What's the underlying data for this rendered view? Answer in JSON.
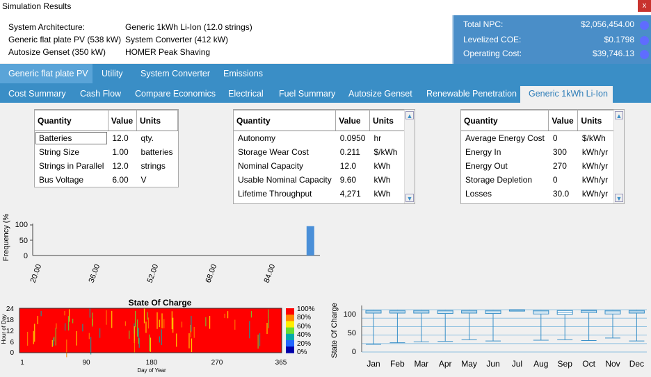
{
  "window": {
    "title": "Simulation Results",
    "close_label": "x"
  },
  "architecture": {
    "rows": [
      {
        "label": "System Architecture:",
        "value": "Generic 1kWh Li-Ion (12.0 strings)"
      },
      {
        "label": "Generic flat plate PV (538 kW)",
        "value": "System Converter (412 kW)"
      },
      {
        "label": "Autosize Genset (350 kW)",
        "value": "HOMER Peak Shaving"
      }
    ]
  },
  "summary": {
    "rows": [
      {
        "label": "Total NPC:",
        "value": "$2,056,454.00"
      },
      {
        "label": "Levelized COE:",
        "value": "$0.1798"
      },
      {
        "label": "Operating Cost:",
        "value": "$39,746.13"
      }
    ]
  },
  "tabs_top": [
    "Generic flat plate PV",
    "Utility",
    "System Converter",
    "Emissions"
  ],
  "tabs_sub": [
    "Cost Summary",
    "Cash Flow",
    "Compare Economics",
    "Electrical",
    "Fuel Summary",
    "Autosize Genset",
    "Renewable Penetration",
    "Generic 1kWh Li-Ion"
  ],
  "table1": {
    "headers": [
      "Quantity",
      "Value",
      "Units"
    ],
    "rows": [
      [
        "Batteries",
        "12.0",
        "qty."
      ],
      [
        "String Size",
        "1.00",
        "batteries"
      ],
      [
        "Strings in Parallel",
        "12.0",
        "strings"
      ],
      [
        "Bus Voltage",
        "6.00",
        "V"
      ]
    ]
  },
  "table2": {
    "headers": [
      "Quantity",
      "Value",
      "Units"
    ],
    "rows": [
      [
        "Autonomy",
        "0.0950",
        "hr"
      ],
      [
        "Storage Wear Cost",
        "0.211",
        "$/kWh"
      ],
      [
        "Nominal Capacity",
        "12.0",
        "kWh"
      ],
      [
        "Usable Nominal Capacity",
        "9.60",
        "kWh"
      ],
      [
        "Lifetime Throughput",
        "4,271",
        "kWh"
      ]
    ]
  },
  "table3": {
    "headers": [
      "Quantity",
      "Value",
      "Units"
    ],
    "rows": [
      [
        "Average Energy Cost",
        "0",
        "$/kWh"
      ],
      [
        "Energy In",
        "300",
        "kWh/yr"
      ],
      [
        "Energy Out",
        "270",
        "kWh/yr"
      ],
      [
        "Storage Depletion",
        "0",
        "kWh/yr"
      ],
      [
        "Losses",
        "30.0",
        "kWh/yr"
      ]
    ]
  },
  "histogram": {
    "type": "bar",
    "ylabel": "Frequency (%",
    "y_ticks": [
      "100",
      "50",
      "0"
    ],
    "x_ticks": [
      "20.00",
      "36.00",
      "52.00",
      "68.00",
      "84.00"
    ],
    "xlim": [
      12,
      100
    ],
    "ylim": [
      0,
      100
    ],
    "bars": [
      {
        "x": 98,
        "value": 96
      }
    ],
    "color": "#4a8fd8"
  },
  "heatmap": {
    "type": "heatmap",
    "title": "State Of Charge",
    "ylabel": "Hour of Day",
    "xlabel": "Day of Year",
    "y_ticks": [
      "24",
      "18",
      "12",
      "6",
      "0"
    ],
    "x_ticks": [
      "1",
      "90",
      "180",
      "270",
      "365"
    ],
    "scale_labels": [
      "100%",
      "80%",
      "60%",
      "40%",
      "20%",
      "0%"
    ],
    "scale_colors": [
      "#ff0000",
      "#ff8800",
      "#ffee00",
      "#66dd33",
      "#00aaaa",
      "#2266ff",
      "#0000aa"
    ]
  },
  "boxplot": {
    "type": "box",
    "ylabel": "State Of Charge",
    "y_ticks": [
      "100",
      "50",
      "0"
    ],
    "ylim": [
      0,
      110
    ],
    "months": [
      "Jan",
      "Feb",
      "Mar",
      "Apr",
      "May",
      "Jun",
      "Jul",
      "Aug",
      "Sep",
      "Oct",
      "Nov",
      "Dec"
    ],
    "boxes": [
      {
        "q1": 92,
        "q3": 98,
        "med": 95,
        "min": 18,
        "max": 99
      },
      {
        "q1": 92,
        "q3": 98,
        "med": 95,
        "min": 22,
        "max": 99
      },
      {
        "q1": 92,
        "q3": 98,
        "med": 95,
        "min": 24,
        "max": 99
      },
      {
        "q1": 91,
        "q3": 98,
        "med": 95,
        "min": 25,
        "max": 99
      },
      {
        "q1": 92,
        "q3": 98,
        "med": 95,
        "min": 29,
        "max": 99
      },
      {
        "q1": 91,
        "q3": 98,
        "med": 95,
        "min": 26,
        "max": 99
      },
      {
        "q1": 97,
        "q3": 100,
        "med": 99,
        "min": 97,
        "max": 100
      },
      {
        "q1": 90,
        "q3": 98,
        "med": 95,
        "min": 28,
        "max": 99
      },
      {
        "q1": 89,
        "q3": 98,
        "med": 94,
        "min": 29,
        "max": 99
      },
      {
        "q1": 93,
        "q3": 99,
        "med": 97,
        "min": 27,
        "max": 99
      },
      {
        "q1": 90,
        "q3": 98,
        "med": 95,
        "min": 33,
        "max": 99
      },
      {
        "q1": 92,
        "q3": 98,
        "med": 95,
        "min": 26,
        "max": 99
      }
    ],
    "color": "#3a90c8"
  }
}
